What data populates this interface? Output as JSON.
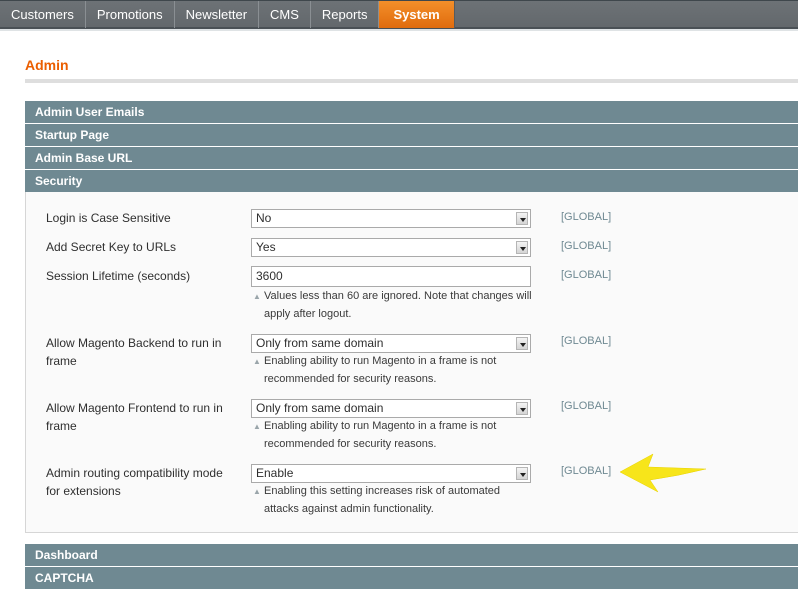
{
  "nav": {
    "tabs": [
      {
        "label": "Customers"
      },
      {
        "label": "Promotions"
      },
      {
        "label": "Newsletter"
      },
      {
        "label": "CMS"
      },
      {
        "label": "Reports"
      },
      {
        "label": "System",
        "active": true
      }
    ]
  },
  "page": {
    "title": "Admin"
  },
  "sections": {
    "admin_user_emails": "Admin User Emails",
    "startup_page": "Startup Page",
    "admin_base_url": "Admin Base URL",
    "security": "Security",
    "dashboard": "Dashboard",
    "captcha": "CAPTCHA"
  },
  "security": {
    "rows": [
      {
        "label": "Login is Case Sensitive",
        "value": "No",
        "type": "select",
        "scope": "[GLOBAL]"
      },
      {
        "label": "Add Secret Key to URLs",
        "value": "Yes",
        "type": "select",
        "scope": "[GLOBAL]"
      },
      {
        "label": "Session Lifetime (seconds)",
        "value": "3600",
        "type": "text",
        "scope": "[GLOBAL]",
        "hint": "Values less than 60 are ignored. Note that changes will apply after logout."
      },
      {
        "label": "Allow Magento Backend to run in frame",
        "value": "Only from same domain",
        "type": "select",
        "scope": "[GLOBAL]",
        "hint": "Enabling ability to run Magento in a frame is not recommended for security reasons."
      },
      {
        "label": "Allow Magento Frontend to run in frame",
        "value": "Only from same domain",
        "type": "select",
        "scope": "[GLOBAL]",
        "hint": "Enabling ability to run Magento in a frame is not recommended for security reasons."
      },
      {
        "label": "Admin routing compatibility mode for extensions",
        "value": "Enable",
        "type": "select",
        "scope": "[GLOBAL]",
        "hint": "Enabling this setting increases risk of automated attacks against admin functionality."
      }
    ]
  },
  "annotation": {
    "arrow_color": "#f7e51a",
    "points_to": "[GLOBAL]"
  }
}
